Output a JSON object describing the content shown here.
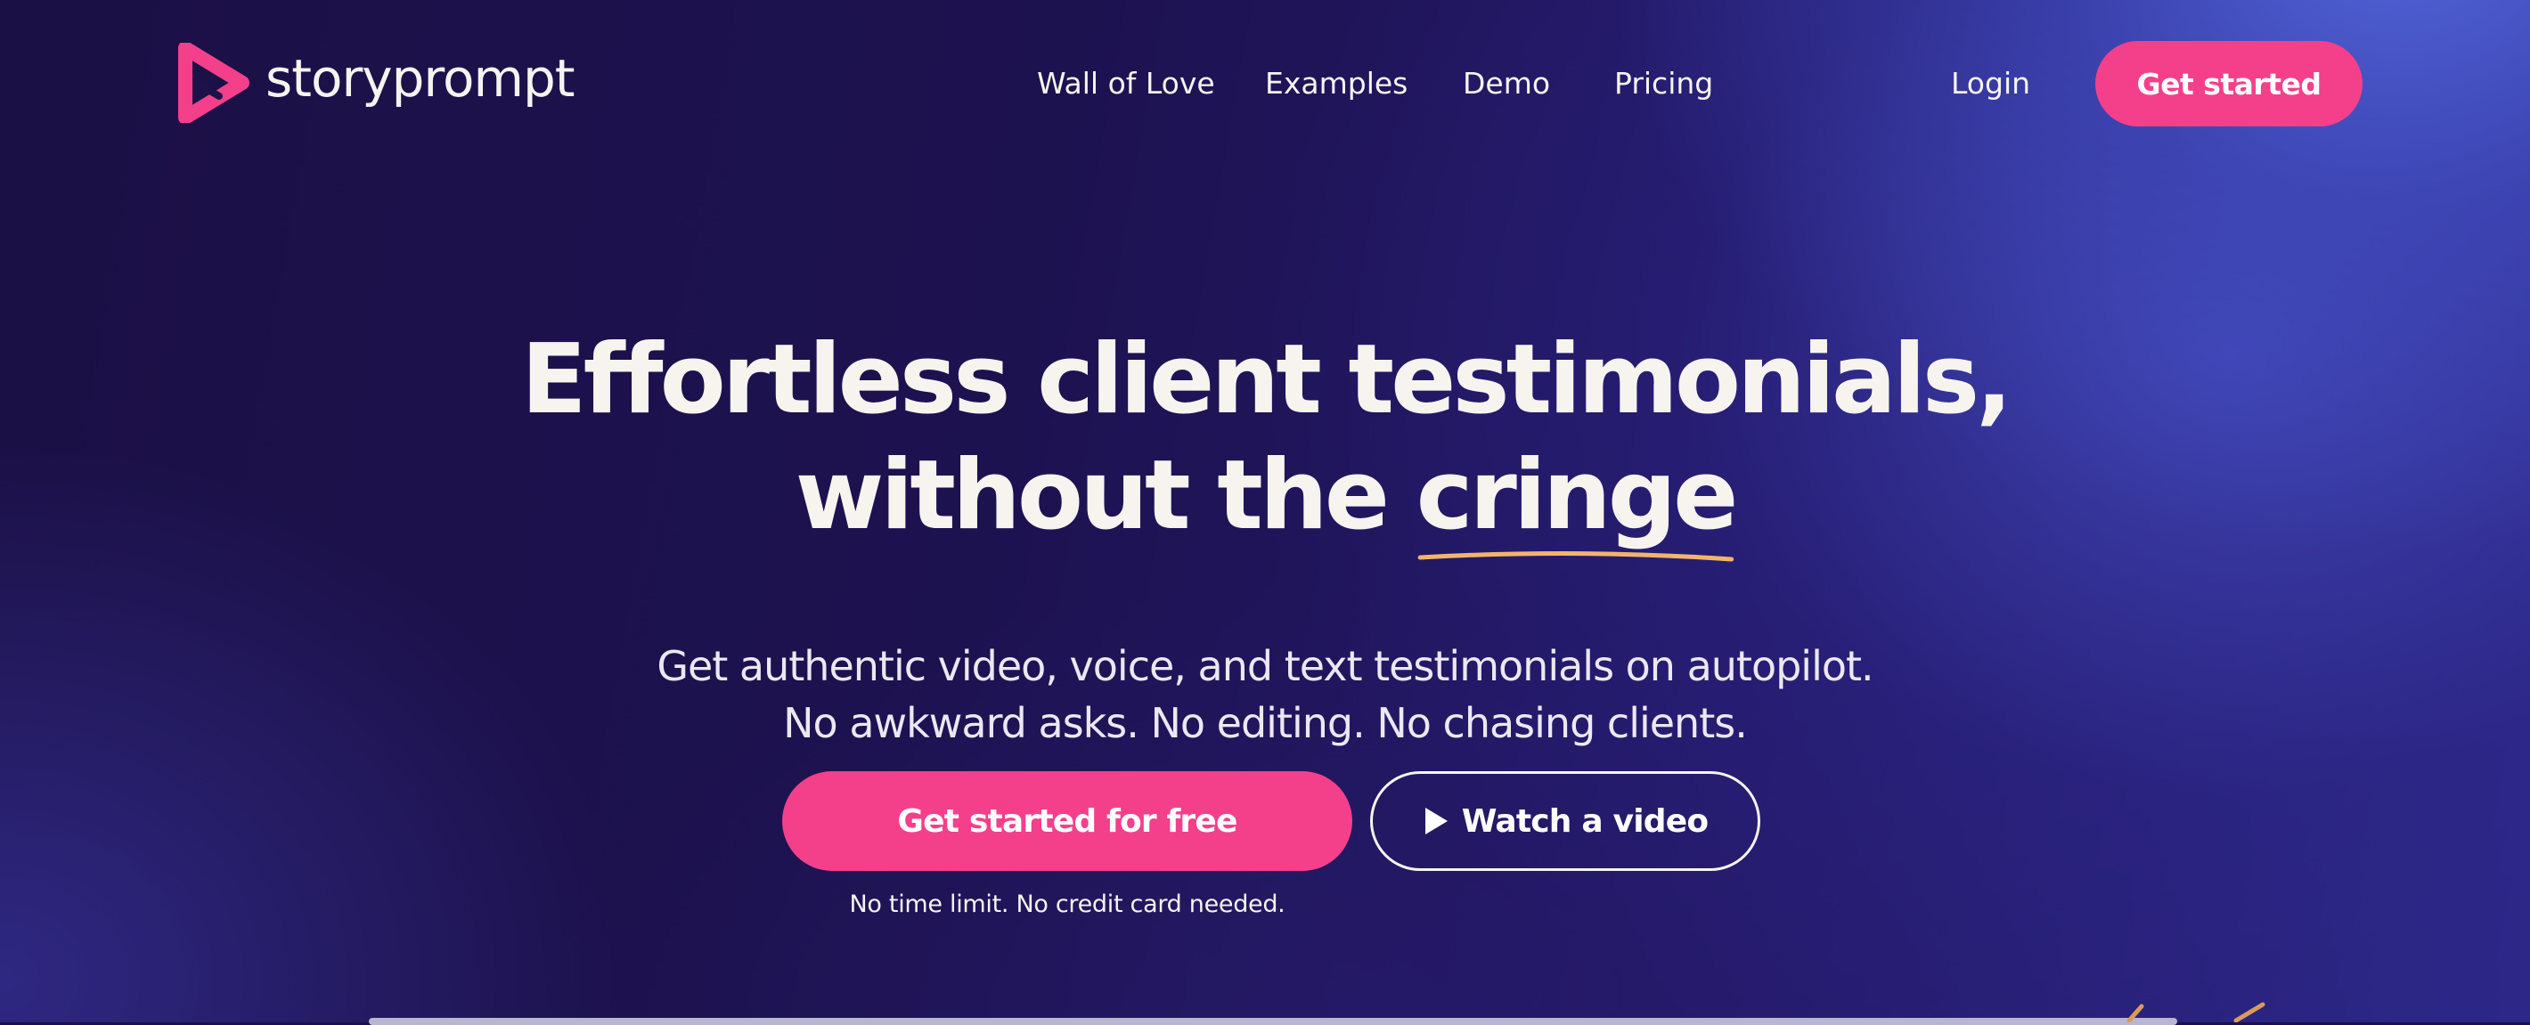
{
  "brand": {
    "name": "storyprompt",
    "accent_color": "#f43f8a",
    "underline_color": "#f2b56b",
    "logo_icon": "play-triangle-logo-icon"
  },
  "nav": {
    "items": [
      {
        "label": "Wall of Love"
      },
      {
        "label": "Examples"
      },
      {
        "label": "Demo"
      },
      {
        "label": "Pricing"
      }
    ],
    "login_label": "Login",
    "cta_label": "Get started"
  },
  "hero": {
    "title_line1": "Effortless client testimonials,",
    "title_line2_prefix": "without the ",
    "title_highlight": "cringe",
    "subtitle_line1": "Get authentic video, voice, and text testimonials on autopilot.",
    "subtitle_line2": "No awkward asks. No editing. No chasing clients.",
    "primary_cta": "Get started for free",
    "secondary_cta": "Watch a video",
    "secondary_icon": "play-icon",
    "note": "No time limit. No credit card needed."
  }
}
